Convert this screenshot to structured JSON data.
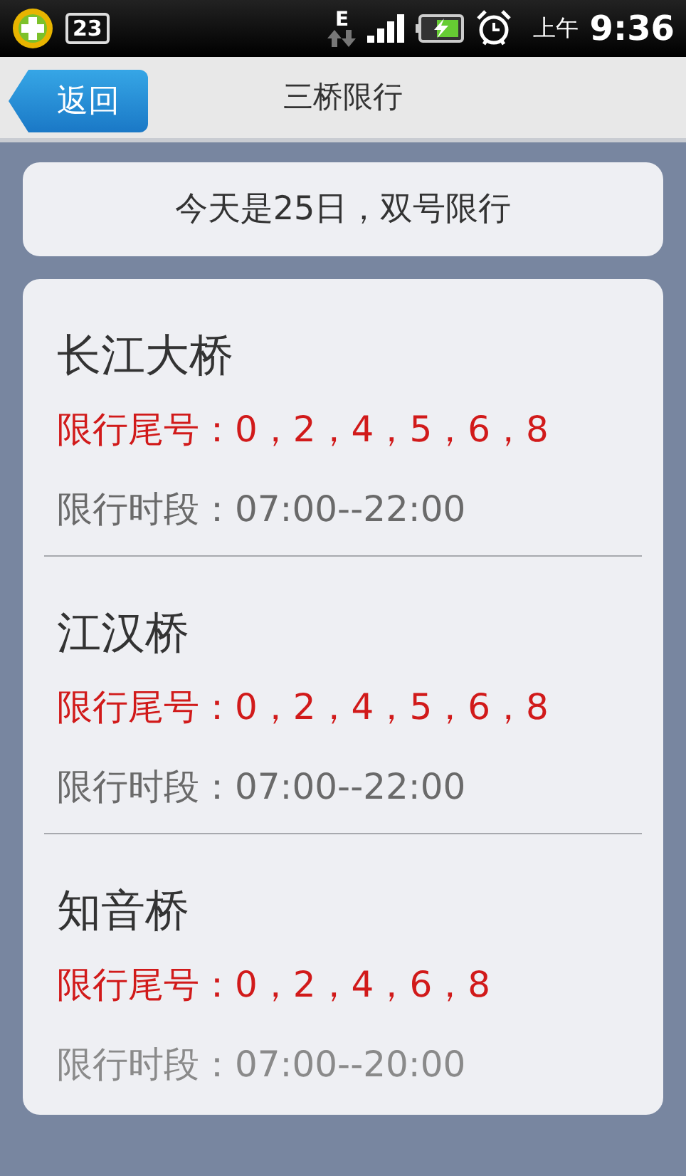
{
  "status_bar": {
    "notification_count": "23",
    "network": "E",
    "ampm": "上午",
    "time": "9:36"
  },
  "header": {
    "back": "返回",
    "title": "三桥限行"
  },
  "notice": "今天是25日，双号限行",
  "bridges": [
    {
      "name": "长江大桥",
      "plates": "限行尾号：0，2，4，5，6，8",
      "hours": "限行时段：07:00--22:00"
    },
    {
      "name": "江汉桥",
      "plates": "限行尾号：0，2，4，5，6，8",
      "hours": "限行时段：07:00--22:00"
    },
    {
      "name": "知音桥",
      "plates": "限行尾号：0，2，4，6，8",
      "hours": "限行时段：07:00--20:00"
    }
  ]
}
